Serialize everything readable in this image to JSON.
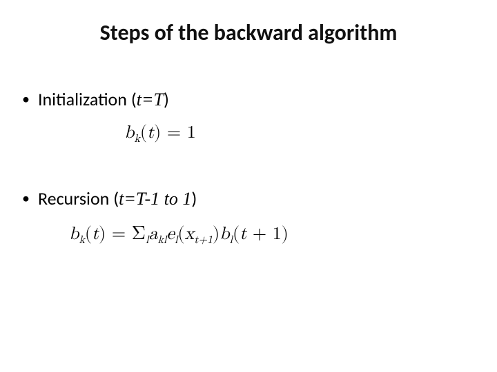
{
  "title": "Steps of the backward algorithm",
  "bullets": {
    "init": {
      "label": "Initialization",
      "paren_open": "(",
      "var_t": "t",
      "eq": "=",
      "var_T": "T",
      "paren_close": ")"
    },
    "rec": {
      "label": "Recursion",
      "paren_open": "(",
      "var_t": "t",
      "eq": "=",
      "var_T": "T",
      "minus1": "-1",
      "to": " to ",
      "one": "1",
      "paren_close": ")"
    }
  },
  "formulas": {
    "init": {
      "b": "b",
      "k": "k",
      "open": "(",
      "t": "t",
      "close": ")",
      "eq": " = ",
      "one": "1"
    },
    "rec": {
      "b": "b",
      "k": "k",
      "open1": "(",
      "t1": "t",
      "close1": ")",
      "eq": " = ",
      "sigma": "Σ",
      "l": "l",
      "a": "a",
      "kl": "kl",
      "e": "e",
      "l2": "l",
      "open2": "(",
      "x": "x",
      "tplus": "t+1",
      "close2": ")",
      "b2": "b",
      "l3": "l",
      "open3": "(",
      "t2": "t",
      "plus1b": " + 1",
      "close3": ")"
    }
  }
}
